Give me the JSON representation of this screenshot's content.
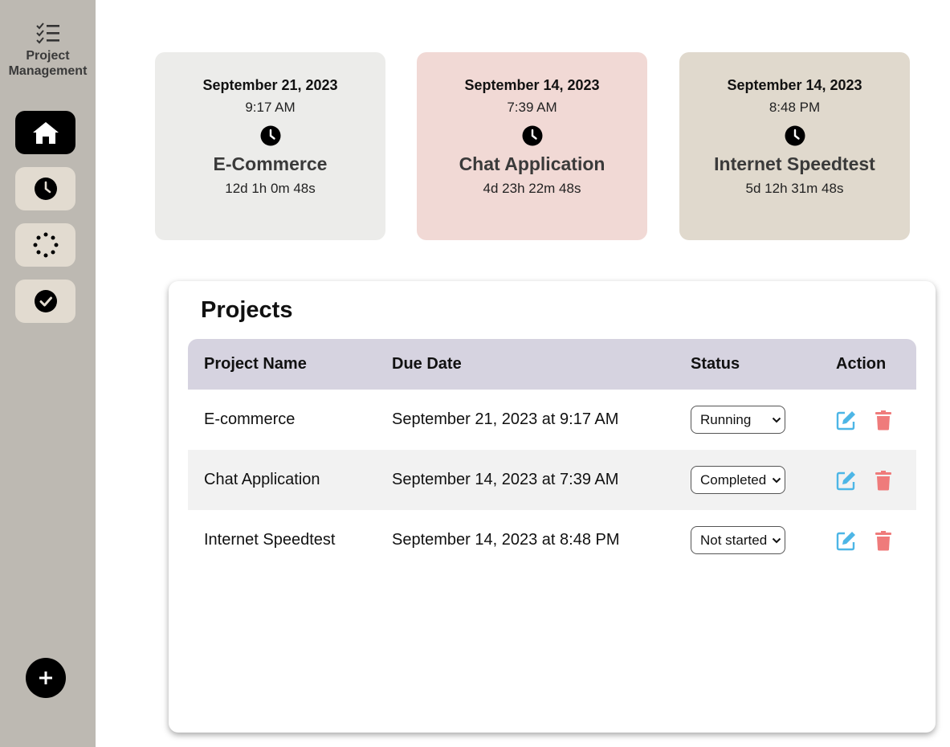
{
  "brand": {
    "icon": "checklist-icon",
    "line1": "Project",
    "line2": "Management"
  },
  "nav": [
    {
      "name": "home",
      "icon": "home-icon",
      "active": true
    },
    {
      "name": "pending",
      "icon": "clock-icon",
      "active": false
    },
    {
      "name": "in-progress",
      "icon": "spinner-icon",
      "active": false
    },
    {
      "name": "completed",
      "icon": "check-circle-icon",
      "active": false
    }
  ],
  "add_button": {
    "icon": "plus-icon",
    "label": "+"
  },
  "cards": [
    {
      "date": "September 21, 2023",
      "time": "9:17 AM",
      "name": "E-Commerce",
      "elapsed": "12d 1h 0m 48s",
      "color": "#ececea"
    },
    {
      "date": "September 14, 2023",
      "time": "7:39 AM",
      "name": "Chat Application",
      "elapsed": "4d 23h 22m 48s",
      "color": "#f1d9d5"
    },
    {
      "date": "September 14, 2023",
      "time": "8:48 PM",
      "name": "Internet Speedtest",
      "elapsed": "5d 12h 31m 48s",
      "color": "#e0d9cd"
    }
  ],
  "projects": {
    "title": "Projects",
    "columns": [
      "Project Name",
      "Due Date",
      "Status",
      "Action"
    ],
    "rows": [
      {
        "name": "E-commerce",
        "due": "September 21, 2023 at 9:17 AM",
        "status": "Running"
      },
      {
        "name": "Chat Application",
        "due": "September 14, 2023 at 7:39 AM",
        "status": "Completed"
      },
      {
        "name": "Internet Speedtest",
        "due": "September 14, 2023 at 8:48 PM",
        "status": "Not started"
      }
    ],
    "edit_color": "#4db6e6",
    "delete_color": "#ef7b7b"
  }
}
